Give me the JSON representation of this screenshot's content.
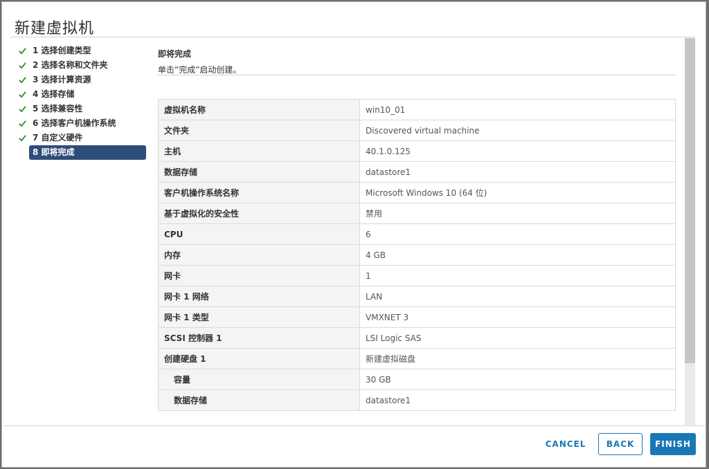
{
  "dialog": {
    "title": "新建虚拟机"
  },
  "sidebar": {
    "steps": [
      {
        "label": "1 选择创建类型",
        "done": true
      },
      {
        "label": "2 选择名称和文件夹",
        "done": true
      },
      {
        "label": "3 选择计算资源",
        "done": true
      },
      {
        "label": "4 选择存储",
        "done": true
      },
      {
        "label": "5 选择兼容性",
        "done": true
      },
      {
        "label": "6 选择客户机操作系统",
        "done": true
      },
      {
        "label": "7 自定义硬件",
        "done": true
      },
      {
        "label": "8 即将完成",
        "done": false,
        "active": true
      }
    ]
  },
  "content": {
    "heading": "即将完成",
    "subtext": "单击“完成”启动创建。",
    "rows": [
      {
        "key": "虚拟机名称",
        "value": "win10_01"
      },
      {
        "key": "文件夹",
        "value": "Discovered virtual machine"
      },
      {
        "key": "主机",
        "value": "40.1.0.125"
      },
      {
        "key": "数据存储",
        "value": "datastore1"
      },
      {
        "key": "客户机操作系统名称",
        "value": "Microsoft Windows 10 (64 位)"
      },
      {
        "key": "基于虚拟化的安全性",
        "value": "禁用"
      },
      {
        "key": "CPU",
        "value": "6"
      },
      {
        "key": "内存",
        "value": "4 GB"
      },
      {
        "key": "网卡",
        "value": "1"
      },
      {
        "key": "网卡 1 网络",
        "value": "LAN"
      },
      {
        "key": "网卡 1 类型",
        "value": "VMXNET 3"
      },
      {
        "key": "SCSI 控制器 1",
        "value": "LSI Logic SAS"
      },
      {
        "key": "创建硬盘 1",
        "value": "新建虚拟磁盘"
      },
      {
        "key": "容量",
        "value": "30 GB",
        "indent": true
      },
      {
        "key": "数据存储",
        "value": "datastore1",
        "indent": true
      }
    ]
  },
  "footer": {
    "cancel_label": "CANCEL",
    "back_label": "BACK",
    "finish_label": "FINISH"
  },
  "colors": {
    "accent": "#1a77b6",
    "active_step_bg": "#2f4d7a",
    "check": "#2e8b2e"
  },
  "icons": {
    "step_done": "check-icon"
  }
}
